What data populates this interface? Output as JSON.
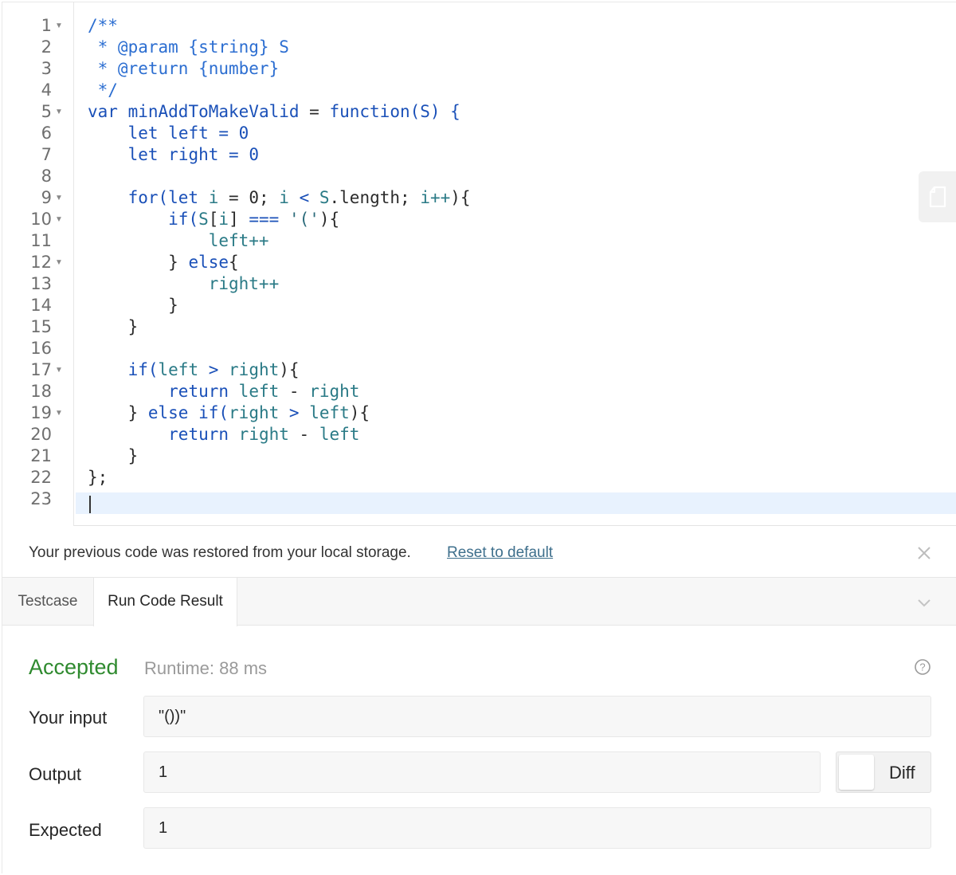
{
  "editor": {
    "line_numbers": [
      "1",
      "2",
      "3",
      "4",
      "5",
      "6",
      "7",
      "8",
      "9",
      "10",
      "11",
      "12",
      "13",
      "14",
      "15",
      "16",
      "17",
      "18",
      "19",
      "20",
      "21",
      "22",
      "23"
    ],
    "fold_lines": [
      1,
      5,
      9,
      10,
      12,
      17,
      19
    ],
    "code": {
      "l1": "/**",
      "l2": " * @param {string} S",
      "l3": " * @return {number}",
      "l4": " */",
      "l5_kw": "var",
      "l5_name": "minAddToMakeValid",
      "l5_op": " = ",
      "l5_fn": "function(S) {",
      "l6_kw": "let",
      "l6_var": "left",
      "l6_rest": " = 0",
      "l7_kw": "let",
      "l7_var": "right",
      "l7_rest": " = 0",
      "l9_kw": "for(let",
      "l9_i": "i",
      "l9_mid": " = 0; ",
      "l9_i2": "i",
      "l9_lt": " < ",
      "l9_s": "S",
      "l9_len": ".length; ",
      "l9_inc": "i++",
      "l9_end": "){",
      "l10_kw": "if(",
      "l10_s": "S",
      "l10_b1": "[",
      "l10_i": "i",
      "l10_b2": "]",
      "l10_op": " === ",
      "l10_str": "'('",
      "l10_end": "){",
      "l11": "left++",
      "l12_br": "} ",
      "l12_kw": "else",
      "l12_end": "{",
      "l13": "right++",
      "l14": "}",
      "l15": "}",
      "l17_kw": "if(",
      "l17_a": "left",
      "l17_op": " > ",
      "l17_b": "right",
      "l17_end": "){",
      "l18_kw": "return",
      "l18_a": "left",
      "l18_op": " - ",
      "l18_b": "right",
      "l19_br": "} ",
      "l19_kw": "else if(",
      "l19_a": "right",
      "l19_op": " > ",
      "l19_b": "left",
      "l19_end": "){",
      "l20_kw": "return",
      "l20_a": "right",
      "l20_op": " - ",
      "l20_b": "left",
      "l21": "}",
      "l22": "};"
    },
    "copy_icon": "copy-icon"
  },
  "notice": {
    "text": "Your previous code was restored from your local storage.",
    "link": "Reset to default",
    "close_icon": "close-icon"
  },
  "tabs": {
    "testcase": "Testcase",
    "result": "Run Code Result",
    "chevron_icon": "chevron-down-icon"
  },
  "result": {
    "status": "Accepted",
    "runtime": "Runtime: 88 ms",
    "status_color": "#2f8a2f",
    "help_icon": "help-circle-icon",
    "input_label": "Your input",
    "input_value": "\"())\"",
    "output_label": "Output",
    "output_value": "1",
    "expected_label": "Expected",
    "expected_value": "1",
    "diff_label": "Diff"
  }
}
